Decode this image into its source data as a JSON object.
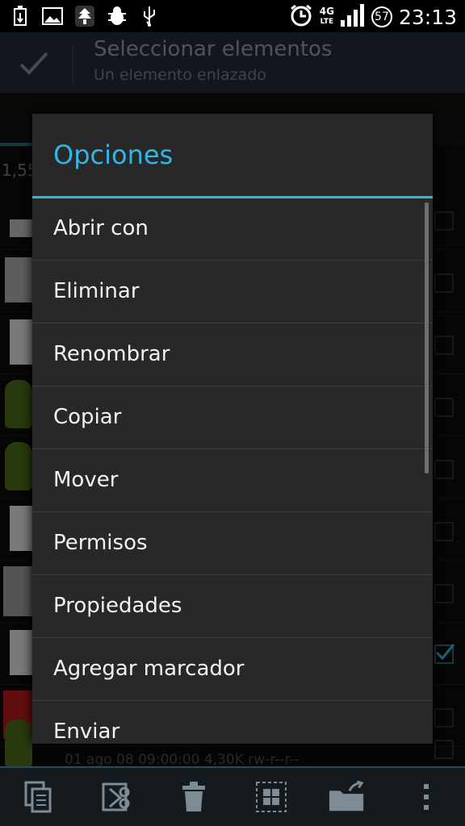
{
  "status_bar": {
    "time": "23:13",
    "battery": "57",
    "network": "4G",
    "network_sub": "LTE",
    "icons": [
      "usb-debug-icon",
      "image-icon",
      "tree-icon",
      "bug-icon",
      "usb-icon",
      "alarm-icon",
      "signal-icon"
    ]
  },
  "action_bar": {
    "title": "Seleccionar elementos",
    "subtitle": "Un elemento enlazado"
  },
  "background": {
    "path_prefix": "1,55",
    "meta": "01 ago 08 09:00:00  4,30K  rw-r--r--"
  },
  "dialog": {
    "title": "Opciones",
    "items": [
      {
        "label": "Abrir con"
      },
      {
        "label": "Eliminar"
      },
      {
        "label": "Renombrar"
      },
      {
        "label": "Copiar"
      },
      {
        "label": "Mover"
      },
      {
        "label": "Permisos"
      },
      {
        "label": "Propiedades"
      },
      {
        "label": "Agregar marcador"
      },
      {
        "label": "Enviar"
      }
    ]
  },
  "bottom_bar": {
    "buttons": [
      "copy-icon",
      "cut-icon",
      "delete-icon",
      "select-all-icon",
      "move-folder-icon",
      "overflow-menu-icon"
    ]
  },
  "colors": {
    "accent": "#33b5e5",
    "dialog_bg": "#282828",
    "action_bar_bg": "#202b33"
  }
}
